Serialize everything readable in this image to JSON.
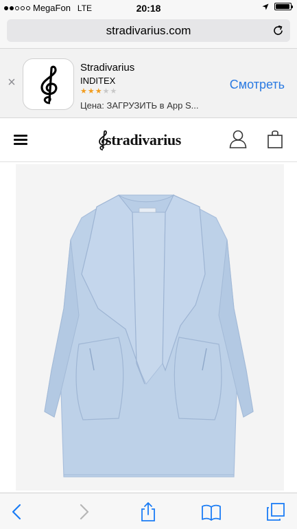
{
  "status_bar": {
    "carrier": "MegaFon",
    "network": "LTE",
    "time": "20:18",
    "signal_bars_filled": 2,
    "signal_bars_total": 5,
    "battery_level": 0.95
  },
  "browser": {
    "url": "stradivarius.com",
    "reload_icon": "reload-icon"
  },
  "app_banner": {
    "close": "×",
    "app_name": "Stradivarius",
    "vendor": "INDITEX",
    "rating": 3,
    "rating_max": 5,
    "price": "Цена: ЗАГРУЗИТЬ в App S...",
    "view_label": "Смотреть",
    "accent_color": "#2a7ae2",
    "star_color": "#f29d1f"
  },
  "site_header": {
    "logo_text": "stradivarius",
    "menu_icon": "hamburger-menu-icon",
    "account_icon": "user-icon",
    "cart_icon": "shopping-bag-icon"
  },
  "product": {
    "image": "light blue wool coat with wide lapels",
    "coat_color": "#bdd1e8"
  },
  "toolbar": {
    "back_icon": "back-chevron-icon",
    "forward_icon": "forward-chevron-icon",
    "share_icon": "share-icon",
    "bookmarks_icon": "bookmarks-icon",
    "tabs_icon": "tabs-icon",
    "accent_color": "#1a7cf5"
  }
}
